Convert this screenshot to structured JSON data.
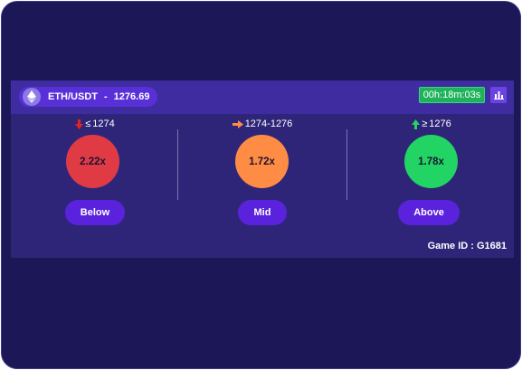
{
  "header": {
    "pair": "ETH/USDT",
    "separator": "-",
    "price": "1276.69",
    "timer": "00h:18m:03s",
    "icons": {
      "coin": "ethereum-icon",
      "chart": "bar-chart-icon"
    }
  },
  "options": [
    {
      "label_symbol": "≤",
      "range": "1274",
      "odds": "2.22x",
      "button": "Below",
      "color": "#e03a45",
      "arrow": "arrow-down-icon",
      "arrow_color": "#e02424"
    },
    {
      "label_symbol": "",
      "range": "1274-1276",
      "odds": "1.72x",
      "button": "Mid",
      "color": "#ff8c45",
      "arrow": "arrow-right-icon",
      "arrow_color": "#ff8c45"
    },
    {
      "label_symbol": "≥",
      "range": "1276",
      "odds": "1.78x",
      "button": "Above",
      "color": "#22d463",
      "arrow": "arrow-up-icon",
      "arrow_color": "#22d463"
    }
  ],
  "footer": {
    "game_id": "Game ID : G1681"
  },
  "colors": {
    "background": "#1c1858",
    "panel": "#2f2578",
    "topbar": "#3f2ca1",
    "button": "#5a22dc",
    "timer": "#1fb25a"
  }
}
